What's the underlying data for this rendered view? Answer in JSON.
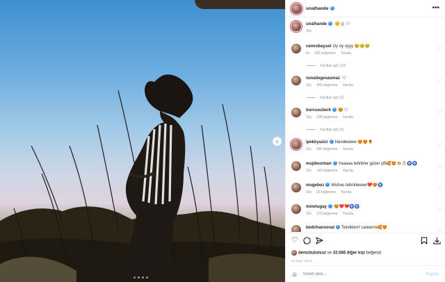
{
  "post": {
    "author": "unalhande",
    "caption_emojis": "😊🧁🤍",
    "caption_time": "15s"
  },
  "comments": [
    {
      "user": "cemrebaysel",
      "verified": false,
      "text": "Oy oy oyyy 🥹🥹🥹",
      "time": "6s",
      "likes": "245 beğenme",
      "reply": "Yanıtla",
      "view_replies": "Yanıtları gör (13)"
    },
    {
      "user": "ismailegesasmaz",
      "verified": false,
      "text": "🤍",
      "time": "15s",
      "likes": "466 beğenme",
      "reply": "Yanıtla",
      "view_replies": "Yanıtları gör (3)"
    },
    {
      "user": "burcuozberk",
      "verified": true,
      "text": "😍🤍",
      "time": "15s",
      "likes": "328 beğenme",
      "reply": "Yanıtla",
      "view_replies": "Yanıtları gör (5)"
    },
    {
      "user": "ipekkyazici",
      "verified": true,
      "text": "Handeeeee 😍😍🌻",
      "time": "15s",
      "likes": "240 beğenme",
      "reply": "Yanıtla",
      "view_replies": ""
    },
    {
      "user": "mujdeuzman",
      "verified": true,
      "text": "Yaaaaa tebrikler güzel çift🥰😍👏🏼👶🏻🧿🧿",
      "time": "15s",
      "likes": "149 beğenme",
      "reply": "Yanıtla",
      "view_replies": ""
    },
    {
      "user": "mugeboz",
      "verified": true,
      "text": "Wuhuu tebrikleeeer❤️😍🧿",
      "time": "15s",
      "likes": "92 beğenme",
      "reply": "Yanıtla",
      "view_replies": ""
    },
    {
      "user": "minetugay",
      "verified": true,
      "text": "😍❤️❤️🧿🧿",
      "time": "15s",
      "likes": "175 beğenme",
      "reply": "Yanıtla",
      "view_replies": ""
    },
    {
      "user": "bedirhansonal",
      "verified": true,
      "text": "Tebriklerrr canlarım🥰😍",
      "time": "",
      "likes": "",
      "reply": "",
      "view_replies": ""
    }
  ],
  "actions": {
    "like_icon": "heart-icon",
    "comment_icon": "comment-icon",
    "share_icon": "send-icon",
    "save_icon": "bookmark-icon",
    "download_icon": "download-icon"
  },
  "likes": {
    "user": "denizbulutsuz",
    "and": "ve",
    "count": "33.586 diğer kişi",
    "suffix": "beğendi"
  },
  "date": "15 SAAT ÖNCE",
  "composer": {
    "placeholder": "Yorum ekle...",
    "share_label": "Paylaş"
  },
  "colors": {
    "accent": "#3897f0",
    "sky_top": "#3f8fcf",
    "sky_low": "#ddd3de"
  }
}
